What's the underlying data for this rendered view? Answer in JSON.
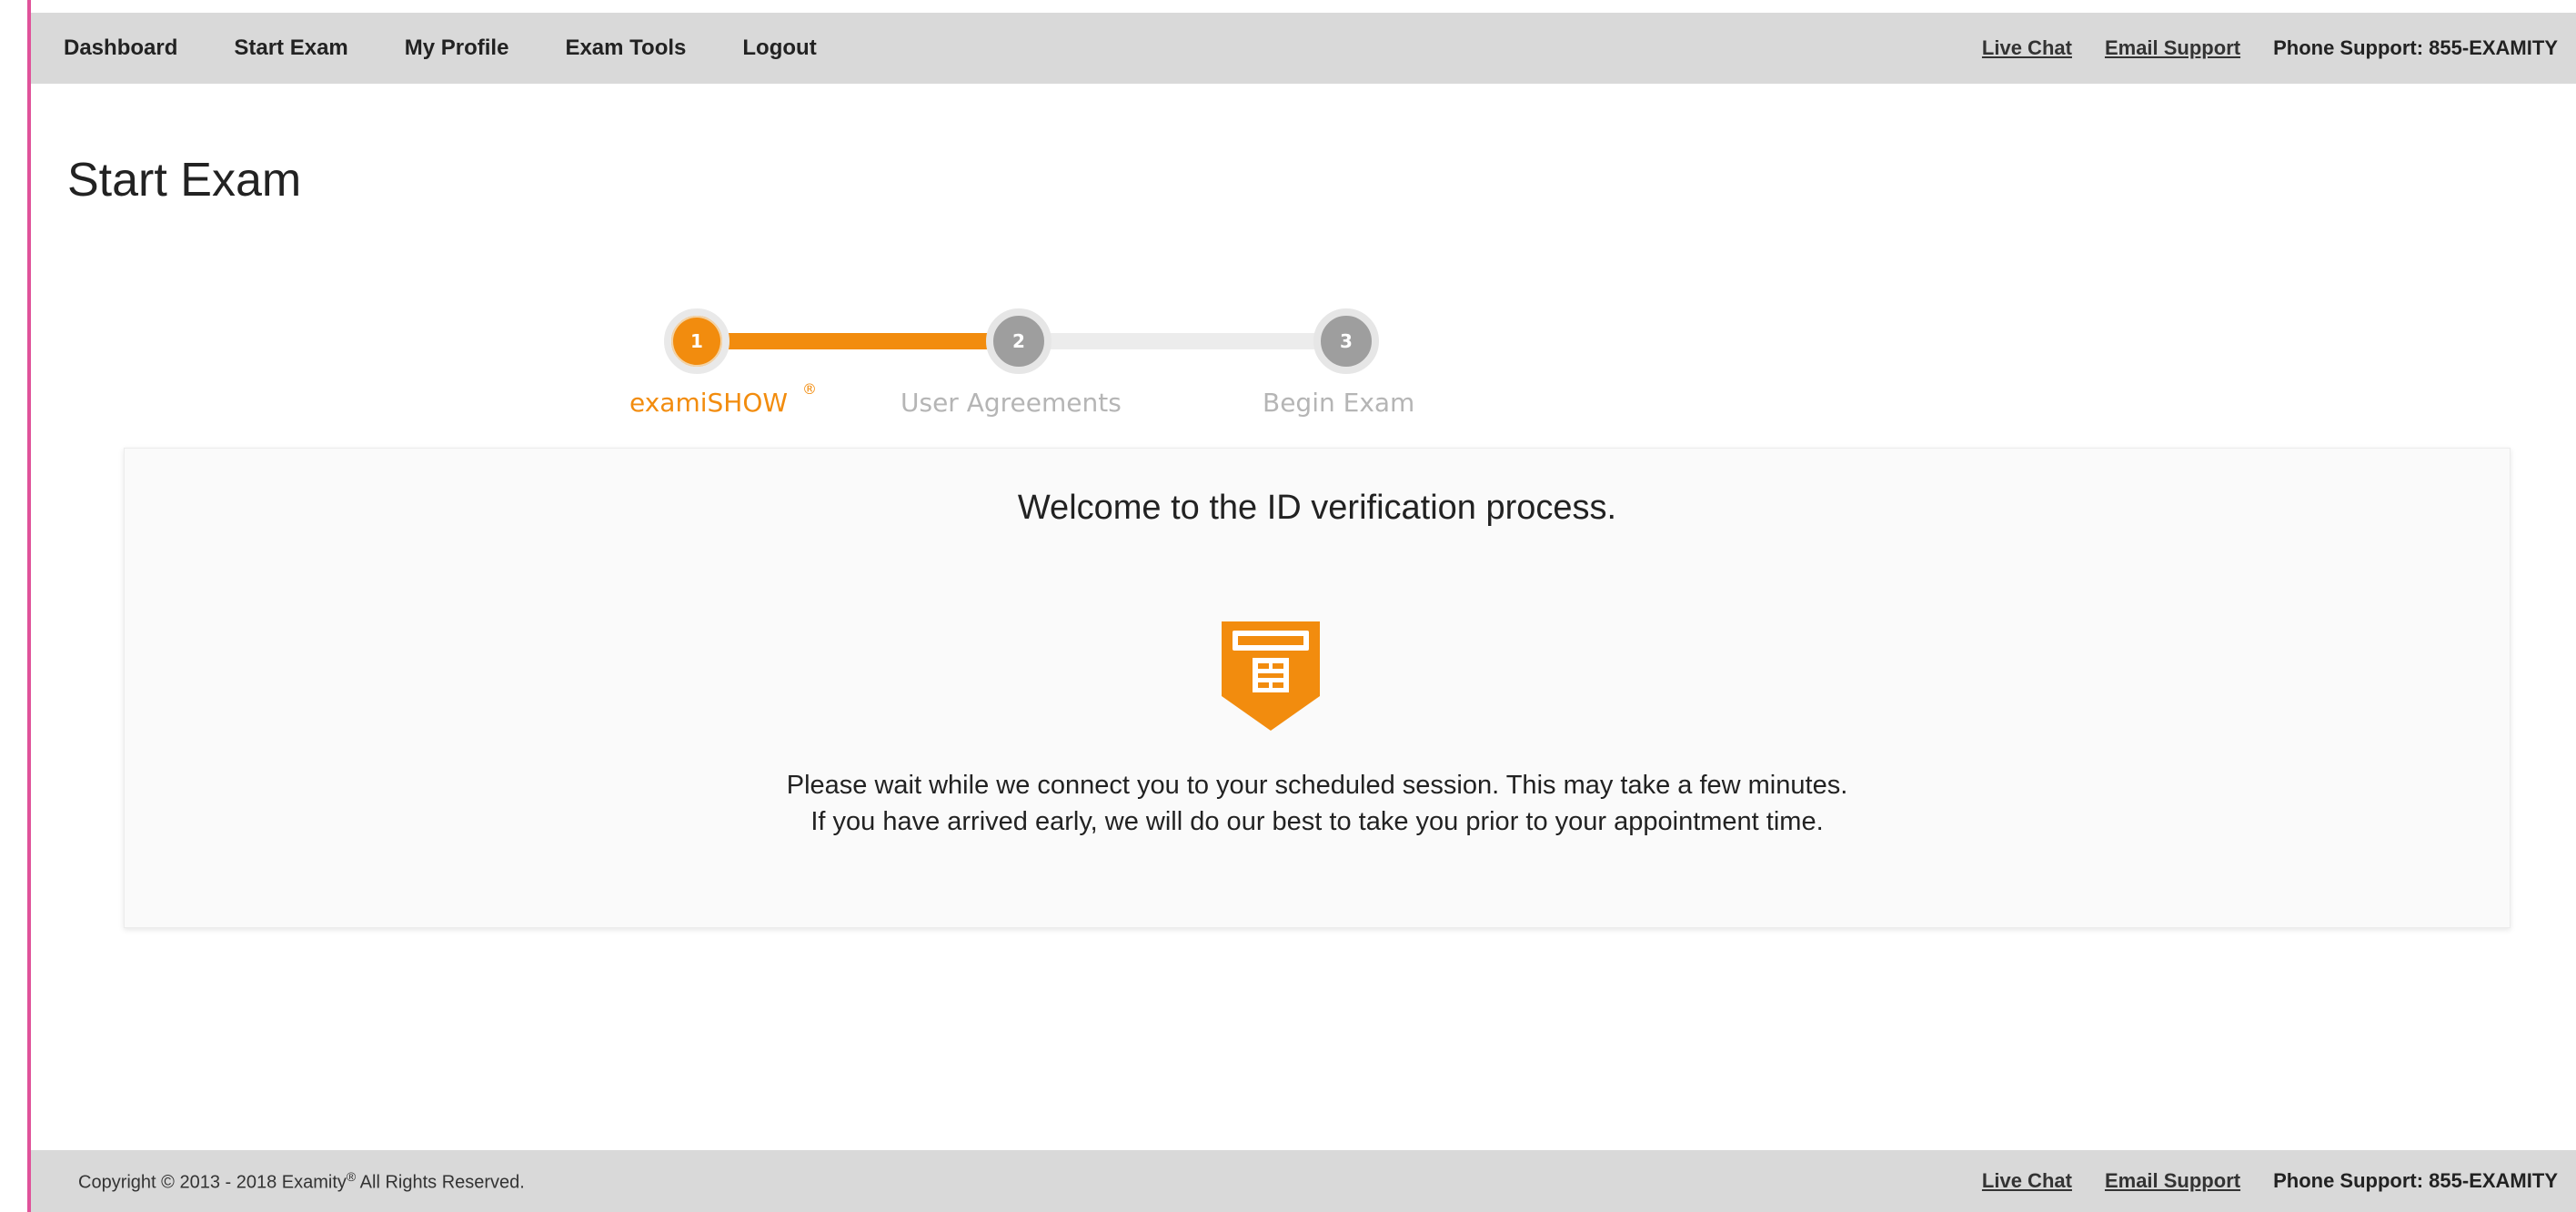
{
  "nav": {
    "items": [
      {
        "label": "Dashboard"
      },
      {
        "label": "Start Exam"
      },
      {
        "label": "My Profile"
      },
      {
        "label": "Exam Tools"
      },
      {
        "label": "Logout"
      }
    ]
  },
  "support": {
    "live_chat": "Live Chat",
    "email_support": "Email Support",
    "phone_support": "Phone Support: 855-EXAMITY"
  },
  "page": {
    "title": "Start Exam"
  },
  "stepper": {
    "steps": [
      {
        "number": "1",
        "label": "examiSHOW",
        "mark": "®",
        "state": "active"
      },
      {
        "number": "2",
        "label": "User Agreements",
        "state": "inactive"
      },
      {
        "number": "3",
        "label": "Begin Exam",
        "state": "inactive"
      }
    ],
    "active_color": "#f28c0e",
    "inactive_color": "#9e9e9e"
  },
  "card": {
    "heading": "Welcome to the ID verification process.",
    "icon": "id-shield-icon",
    "message_line1": "Please wait while we connect you to your scheduled session. This may take a few minutes.",
    "message_line2": "If you have arrived early, we will do our best to take you prior to your appointment time."
  },
  "footer": {
    "copyright_prefix": "Copyright © 2013 - 2018 Examity",
    "copyright_mark": "®",
    "copyright_suffix": " All Rights Reserved.",
    "live_chat": "Live Chat",
    "email_support": "Email Support",
    "phone_support": "Phone Support: 855-EXAMITY"
  },
  "colors": {
    "nav_bg": "#d9d9d9",
    "accent": "#f28c0e",
    "left_border": "#e0529a"
  }
}
